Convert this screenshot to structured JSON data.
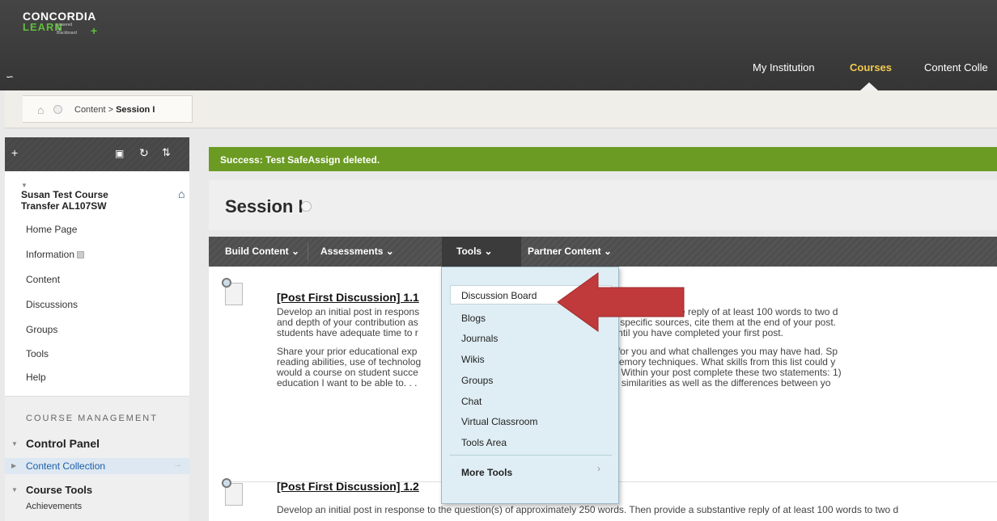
{
  "header": {
    "logo_line1": "CONCORDIA",
    "logo_line2": "LEARN",
    "logo_tag": "powered by Blackboard",
    "nav": [
      "My Institution",
      "Courses",
      "Content Colle"
    ]
  },
  "breadcrumb": {
    "parent": "Content",
    "separator": ">",
    "current": "Session I"
  },
  "sidebar": {
    "course_title_line1": "Susan Test Course",
    "course_title_line2": "Transfer AL107SW",
    "links": [
      "Home Page",
      "Information",
      "Content",
      "Discussions",
      "Groups",
      "Tools",
      "Help"
    ],
    "management_label": "COURSE MANAGEMENT",
    "control_panel": "Control Panel",
    "content_collection": "Content Collection",
    "course_tools": "Course Tools",
    "achievements": "Achievements"
  },
  "main": {
    "success_message": "Success: Test SafeAssign deleted.",
    "page_title": "Session I",
    "actions": [
      "Build Content",
      "Assessments",
      "Tools",
      "Partner Content"
    ],
    "items": [
      {
        "title": "[Post First Discussion] 1.1",
        "lines": [
          "Develop an initial post in respons                                  y 250 words. Then provide a substantive reply of at least 100 words to two d",
          "and depth of your contribution as                                   nd replies. If you refer to specific sources, cite them at the end of your post.",
          "students have adequate time to r                                    l not see others' posts until you have completed your first post.",
          "Share your prior educational exp                                    ms of what worked well for you and what challenges you may have had. Sp",
          "reading abilities, use of technolog                                  -taking strategies, and memory techniques. What skills from this list could y",
          "would a course on student succe                                     ture CUW coursework? Within your post complete these two statements: 1)",
          "education I want to be able to. . .                                  assmates' posts, note the similarities as well as the differences between yo"
        ]
      },
      {
        "title": "[Post First Discussion] 1.2",
        "lines": [
          "Develop an initial post in response to the question(s) of approximately 250 words. Then provide a substantive reply of at least 100 words to two d"
        ]
      }
    ]
  },
  "tools_menu": {
    "items": [
      "Discussion Board",
      "Blogs",
      "Journals",
      "Wikis",
      "Groups",
      "Chat",
      "Virtual Classroom",
      "Tools Area"
    ],
    "more": "More Tools"
  },
  "colors": {
    "success_green": "#6b9b23",
    "arrow_red": "#c0393b",
    "courses_gold": "#f2c94c"
  }
}
